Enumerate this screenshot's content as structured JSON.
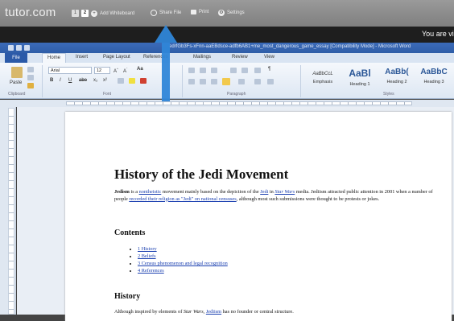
{
  "topbar": {
    "logo": "tutor.com",
    "pages": [
      "1",
      "2"
    ],
    "add_whiteboard": "Add Whiteboard",
    "share_file": "Share File",
    "print": "Print",
    "settings": "Settings"
  },
  "notice": {
    "text": "You are vie"
  },
  "window": {
    "title": "edrfGb3Fs-xFnn-aaEBdsce-adfb6AB1+me_most_dangerous_game_essay [Compatibility Mode] - Microsoft Word"
  },
  "ribbon_tabs": [
    "File",
    "Home",
    "Insert",
    "Page Layout",
    "References",
    "Mailings",
    "Review",
    "View"
  ],
  "ribbon": {
    "paste": "Paste",
    "font_name": "Arial",
    "font_size": "12",
    "groups": {
      "clipboard": "Clipboard",
      "font": "Font",
      "paragraph": "Paragraph",
      "styles": "Styles"
    },
    "styles": [
      {
        "sample": "AaBbCcL",
        "name": "Emphasis"
      },
      {
        "sample": "AaBl",
        "name": "Heading 1"
      },
      {
        "sample": "AaBb(",
        "name": "Heading 2"
      },
      {
        "sample": "AaBbC",
        "name": "Heading 3"
      }
    ]
  },
  "document": {
    "title": "History of the Jedi Movement",
    "intro": {
      "b1": "Jedism",
      "t1": " is a ",
      "l1": "nontheistic",
      "t2": " movement mainly based on the depiction of the ",
      "l2": "Jedi",
      "t3": " in ",
      "l3": "Star Wars",
      "t4": " media. Jediism attracted public attention in 2001 when a number of people ",
      "l4": "recorded their religion as \"Jedi\" on national censuses",
      "t5": ", although most such submissions were thought to be protests or jokes."
    },
    "contents_heading": "Contents",
    "toc": [
      "1 History",
      "2 Beliefs",
      "3 Census phenomenon and legal recognition",
      "4 References"
    ],
    "history_heading": "History",
    "history_text_1": "Although inspired by elements of ",
    "history_text_2": "Star Wars",
    "history_text_3": ", ",
    "history_text_4": "Jediism",
    "history_text_5": " has no founder or central structure."
  }
}
